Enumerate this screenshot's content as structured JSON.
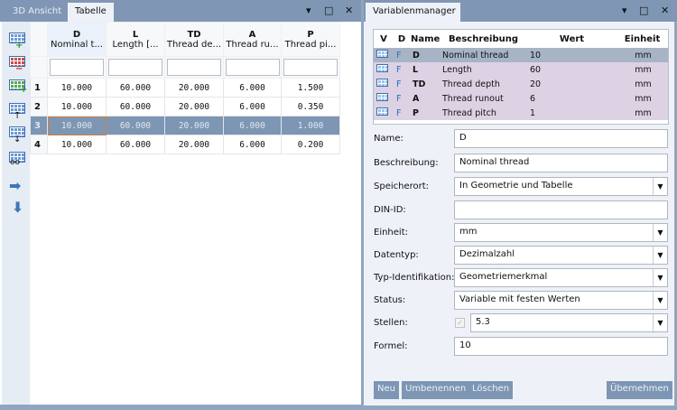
{
  "left_panel": {
    "tabs": [
      "3D Ansicht",
      "Tabelle"
    ],
    "controls": [
      "▾",
      "□",
      "✕"
    ]
  },
  "table": {
    "columns": [
      {
        "key": "D",
        "desc": "Nominal t..."
      },
      {
        "key": "L",
        "desc": "Length [..."
      },
      {
        "key": "TD",
        "desc": "Thread de..."
      },
      {
        "key": "A",
        "desc": "Thread ru..."
      },
      {
        "key": "P",
        "desc": "Thread pi..."
      }
    ],
    "rows": [
      [
        "1",
        "10.000",
        "60.000",
        "20.000",
        "6.000",
        "1.500"
      ],
      [
        "2",
        "10.000",
        "60.000",
        "20.000",
        "6.000",
        "0.350"
      ],
      [
        "3",
        "10.000",
        "60.000",
        "20.000",
        "6.000",
        "1.000"
      ],
      [
        "4",
        "10.000",
        "60.000",
        "20.000",
        "6.000",
        "0.200"
      ]
    ],
    "selected_row": 3
  },
  "right_panel": {
    "title": "Variablenmanager",
    "controls": [
      "▾",
      "□",
      "✕"
    ]
  },
  "variables": {
    "headers": [
      "V",
      "D",
      "Name",
      "Beschreibung",
      "Wert",
      "Einheit"
    ],
    "rows": [
      [
        "D",
        "Nominal thread",
        "10",
        "mm"
      ],
      [
        "L",
        "Length",
        "60",
        "mm"
      ],
      [
        "TD",
        "Thread depth",
        "20",
        "mm"
      ],
      [
        "A",
        "Thread runout",
        "6",
        "mm"
      ],
      [
        "P",
        "Thread pitch",
        "1",
        "mm"
      ]
    ],
    "d_flag": "F"
  },
  "form": {
    "name_label": "Name:",
    "name": "D",
    "beschreibung_label": "Beschreibung:",
    "beschreibung": "Nominal thread",
    "speicherort_label": "Speicherort:",
    "speicherort": "In Geometrie und Tabelle",
    "din_label": "DIN-ID:",
    "din": "",
    "einheit_label": "Einheit:",
    "einheit": "mm",
    "datentyp_label": "Datentyp:",
    "datentyp": "Dezimalzahl",
    "typ_label": "Typ-Identifikation:",
    "typ": "Geometriemerkmal",
    "status_label": "Status:",
    "status": "Variable mit festen Werten",
    "stellen_label": "Stellen:",
    "stellen": "5.3",
    "formel_label": "Formel:",
    "formel": "10"
  },
  "buttons": {
    "neu": "Neu",
    "umbenennen": "Umbenennen",
    "loeschen": "Löschen",
    "uebernehmen": "Übernehmen"
  }
}
